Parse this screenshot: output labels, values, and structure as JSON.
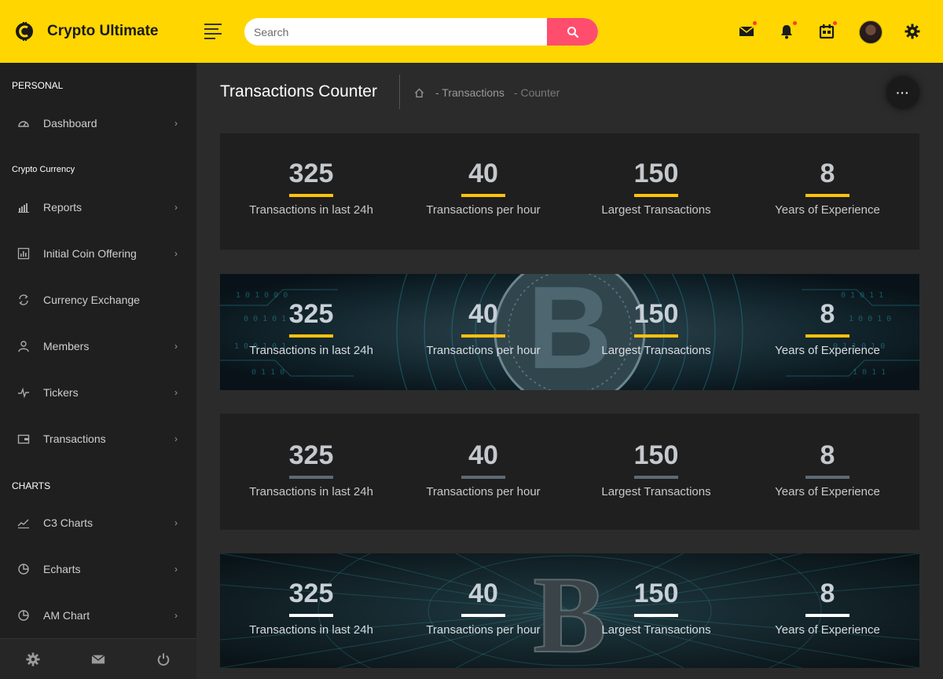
{
  "app": {
    "name": "Crypto Ultimate",
    "accent": "#ffd600",
    "search_accent": "#ff4d6d"
  },
  "header": {
    "search_placeholder": "Search",
    "icons": [
      "menu-icon",
      "search-icon",
      "mail-icon",
      "bell-icon",
      "calendar-icon",
      "avatar",
      "gear-icon"
    ]
  },
  "sidebar": {
    "sections": [
      {
        "title": "PERSONAL",
        "items": [
          {
            "label": "Dashboard",
            "icon": "speedometer-icon"
          }
        ]
      },
      {
        "title": "Crypto Currency",
        "items": [
          {
            "label": "Reports",
            "icon": "bar-chart-icon"
          },
          {
            "label": "Initial Coin Offering",
            "icon": "ico-chart-icon"
          },
          {
            "label": "Currency Exchange",
            "icon": "exchange-icon"
          },
          {
            "label": "Members",
            "icon": "user-icon"
          },
          {
            "label": "Tickers",
            "icon": "pulse-icon"
          },
          {
            "label": "Transactions",
            "icon": "wallet-icon"
          }
        ]
      },
      {
        "title": "CHARTS",
        "items": [
          {
            "label": "C3 Charts",
            "icon": "trend-icon"
          },
          {
            "label": "Echarts",
            "icon": "pie-icon"
          },
          {
            "label": "AM Chart",
            "icon": "pie-icon"
          }
        ]
      }
    ],
    "chevron": "›",
    "footer_icons": [
      "gear-icon",
      "mail-icon",
      "power-icon"
    ]
  },
  "page": {
    "title": "Transactions Counter",
    "breadcrumb": [
      "- Transactions",
      "- Counter"
    ],
    "more_label": "···"
  },
  "counters": [
    {
      "value": "325",
      "label": "Transactions in last 24h"
    },
    {
      "value": "40",
      "label": "Transactions per hour"
    },
    {
      "value": "150",
      "label": "Largest Transactions"
    },
    {
      "value": "8",
      "label": "Years of Experience"
    }
  ],
  "counter_cards": [
    {
      "style": "dark",
      "bar_color": "#ffc20e"
    },
    {
      "style": "photo-circuit",
      "bar_color": "#ffc20e"
    },
    {
      "style": "dark",
      "bar_color": "#5d6b76"
    },
    {
      "style": "photo-network",
      "bar_color": "#ffffff"
    }
  ]
}
